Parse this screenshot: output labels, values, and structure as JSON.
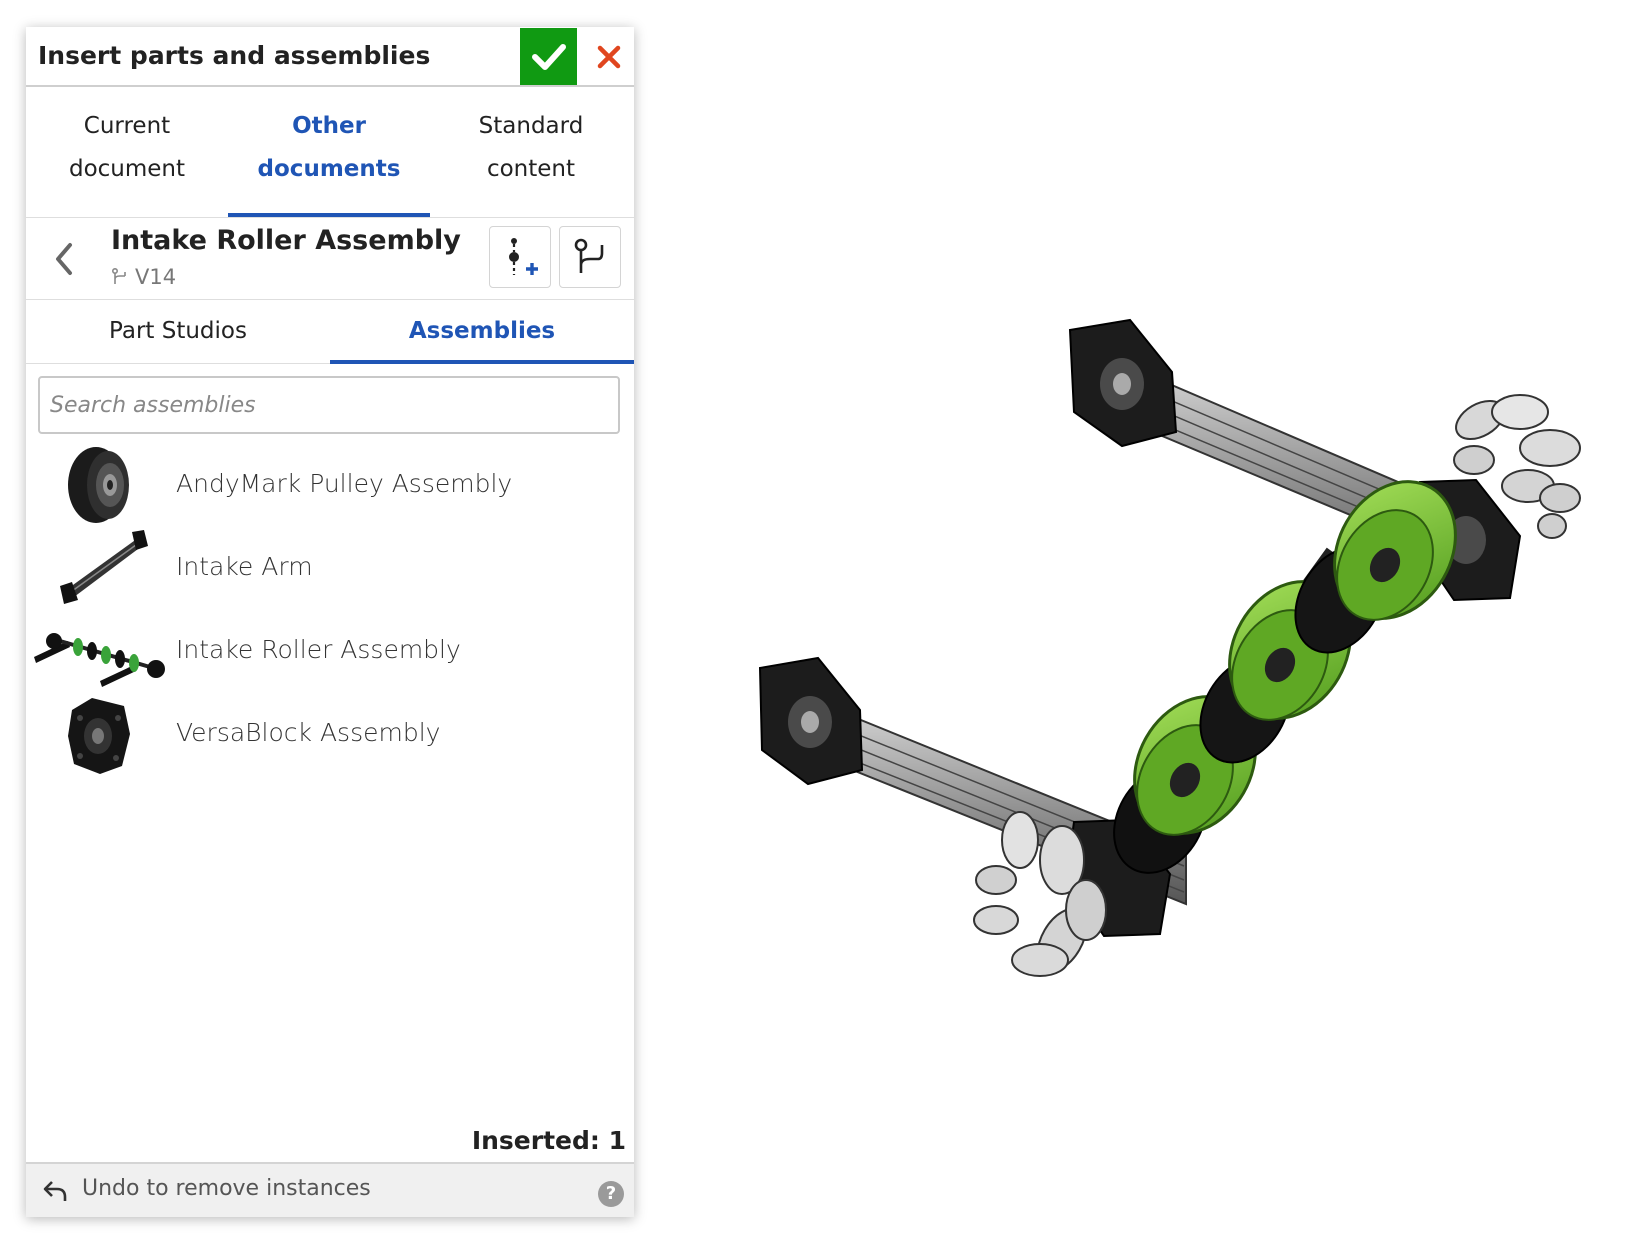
{
  "dialog": {
    "title": "Insert parts and assemblies",
    "confirm_icon": "check-icon",
    "cancel_icon": "close-icon",
    "accent_color": "#1f55b5",
    "confirm_color": "#109a12",
    "cancel_color": "#e0461f"
  },
  "source_tabs": [
    {
      "line1": "Current",
      "line2": "document",
      "active": false
    },
    {
      "line1": "Other",
      "line2": "documents",
      "active": true
    },
    {
      "line1": "Standard",
      "line2": "content",
      "active": false
    }
  ],
  "document": {
    "name": "Intake Roller Assembly",
    "version": "V14",
    "back_icon": "chevron-left-icon",
    "version_icon": "branch-icon",
    "insert_version_icon": "insert-version-icon",
    "branch_button_icon": "branch-icon"
  },
  "element_tabs": [
    {
      "label": "Part Studios",
      "active": false
    },
    {
      "label": "Assemblies",
      "active": true
    }
  ],
  "search": {
    "placeholder": "Search assemblies",
    "value": ""
  },
  "assemblies": [
    {
      "label": "AndyMark Pulley Assembly",
      "thumb": "pulley-thumbnail"
    },
    {
      "label": "Intake Arm",
      "thumb": "intake-arm-thumbnail"
    },
    {
      "label": "Intake Roller Assembly",
      "thumb": "intake-roller-thumbnail"
    },
    {
      "label": "VersaBlock Assembly",
      "thumb": "versablock-thumbnail"
    }
  ],
  "status": {
    "inserted": "Inserted: 1"
  },
  "footer": {
    "undo_label": "Undo to remove instances",
    "undo_icon": "undo-icon",
    "help_icon": "help-icon",
    "help_glyph": "?"
  },
  "viewport": {
    "model": "intake-roller-assembly-3d-view",
    "wheel_color": "#79c52e",
    "frame_color": "#b5b5b5"
  }
}
